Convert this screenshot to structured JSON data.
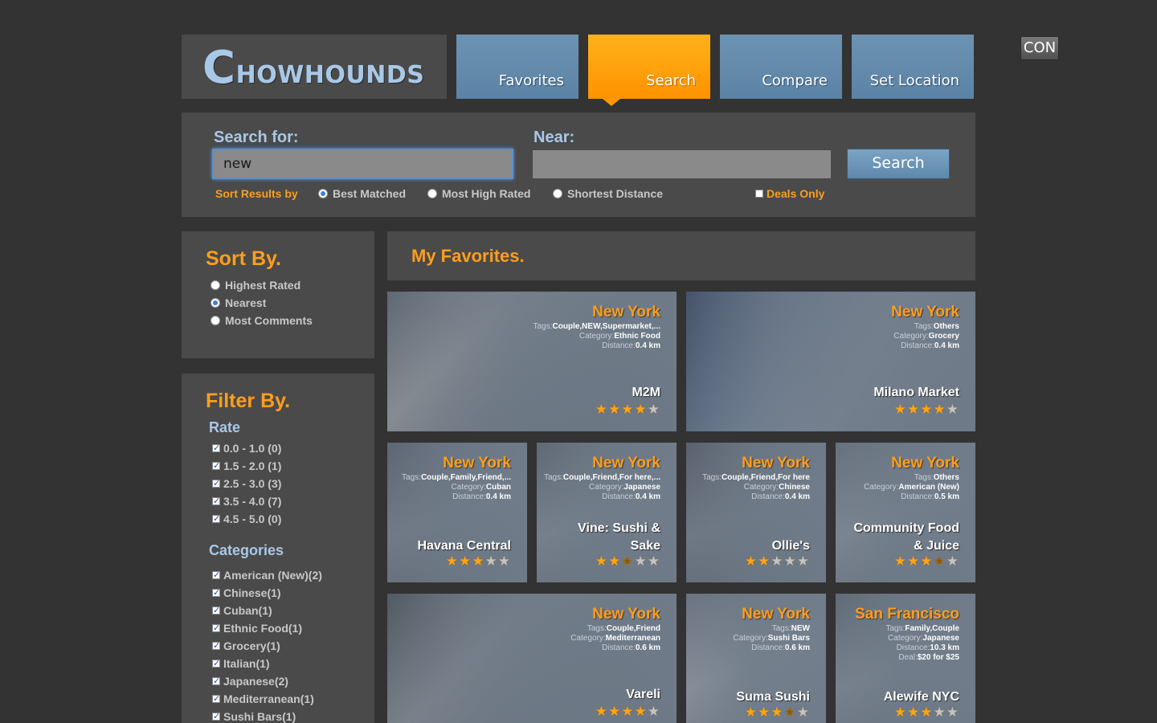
{
  "header": {
    "logo_first": "C",
    "logo_rest": "HOWHOUNDS",
    "tabs": [
      {
        "label": "Favorites",
        "active": false
      },
      {
        "label": "Search",
        "active": true
      },
      {
        "label": "Compare",
        "active": false
      },
      {
        "label": "Set Location",
        "active": false
      }
    ],
    "con_button": "CON"
  },
  "search": {
    "for_label": "Search for:",
    "for_value": "new",
    "near_label": "Near:",
    "near_value": "",
    "button": "Search",
    "sort_label": "Sort Results by",
    "sort_options": [
      {
        "label": "Best Matched",
        "checked": true
      },
      {
        "label": "Most High Rated",
        "checked": false
      },
      {
        "label": "Shortest Distance",
        "checked": false
      }
    ],
    "deals_label": "Deals Only",
    "deals_checked": false
  },
  "sidebar": {
    "sort_title": "Sort By.",
    "sort_options": [
      {
        "label": "Highest Rated",
        "checked": false
      },
      {
        "label": "Nearest",
        "checked": true
      },
      {
        "label": "Most Comments",
        "checked": false
      }
    ],
    "filter_title": "Filter By.",
    "rate_title": "Rate",
    "rates": [
      "0.0 - 1.0 (0)",
      "1.5 - 2.0 (1)",
      "2.5 - 3.0 (3)",
      "3.5 - 4.0 (7)",
      "4.5 - 5.0 (0)"
    ],
    "categories_title": "Categories",
    "categories": [
      "American (New)(2)",
      "Chinese(1)",
      "Cuban(1)",
      "Ethnic Food(1)",
      "Grocery(1)",
      "Italian(1)",
      "Japanese(2)",
      "Mediterranean(1)",
      "Sushi Bars(1)"
    ]
  },
  "favorites": {
    "title": "My Favorites.",
    "labels": {
      "tags": "Tags:",
      "category": "Category:",
      "distance": "Distance:",
      "deal": "Deal:"
    },
    "cards": [
      {
        "city": "New York",
        "tags": "Couple,NEW,Supermarket,...",
        "category": "Ethnic Food",
        "distance": "0.4 km",
        "deal": "",
        "name": "M2M",
        "rating": 4
      },
      {
        "city": "New York",
        "tags": "Others",
        "category": "Grocery",
        "distance": "0.4 km",
        "deal": "",
        "name": "Milano Market",
        "rating": 4
      },
      {
        "city": "New York",
        "tags": "Couple,Family,Friend,...",
        "category": "Cuban",
        "distance": "0.4 km",
        "deal": "",
        "name": "Havana Central",
        "rating": 3
      },
      {
        "city": "New York",
        "tags": "Couple,Friend,For here,...",
        "category": "Japanese",
        "distance": "0.4 km",
        "deal": "",
        "name": "Vine: Sushi & Sake",
        "rating": 2.5
      },
      {
        "city": "New York",
        "tags": "Couple,Friend,For here",
        "category": "Chinese",
        "distance": "0.4 km",
        "deal": "",
        "name": "Ollie's",
        "rating": 2
      },
      {
        "city": "New York",
        "tags": "Others",
        "category": "American (New)",
        "distance": "0.5 km",
        "deal": "",
        "name": "Community Food & Juice",
        "rating": 3.5
      },
      {
        "city": "New York",
        "tags": "Couple,Friend",
        "category": "Mediterranean",
        "distance": "0.6 km",
        "deal": "",
        "name": "Vareli",
        "rating": 4
      },
      {
        "city": "New York",
        "tags": "NEW",
        "category": "Sushi Bars",
        "distance": "0.6 km",
        "deal": "",
        "name": "Suma Sushi",
        "rating": 3.5
      },
      {
        "city": "San Francisco",
        "tags": "Family,Couple",
        "category": "Japanese",
        "distance": "10.3 km",
        "deal": "$20 for $25",
        "name": "Alewife NYC",
        "rating": 3
      }
    ]
  }
}
